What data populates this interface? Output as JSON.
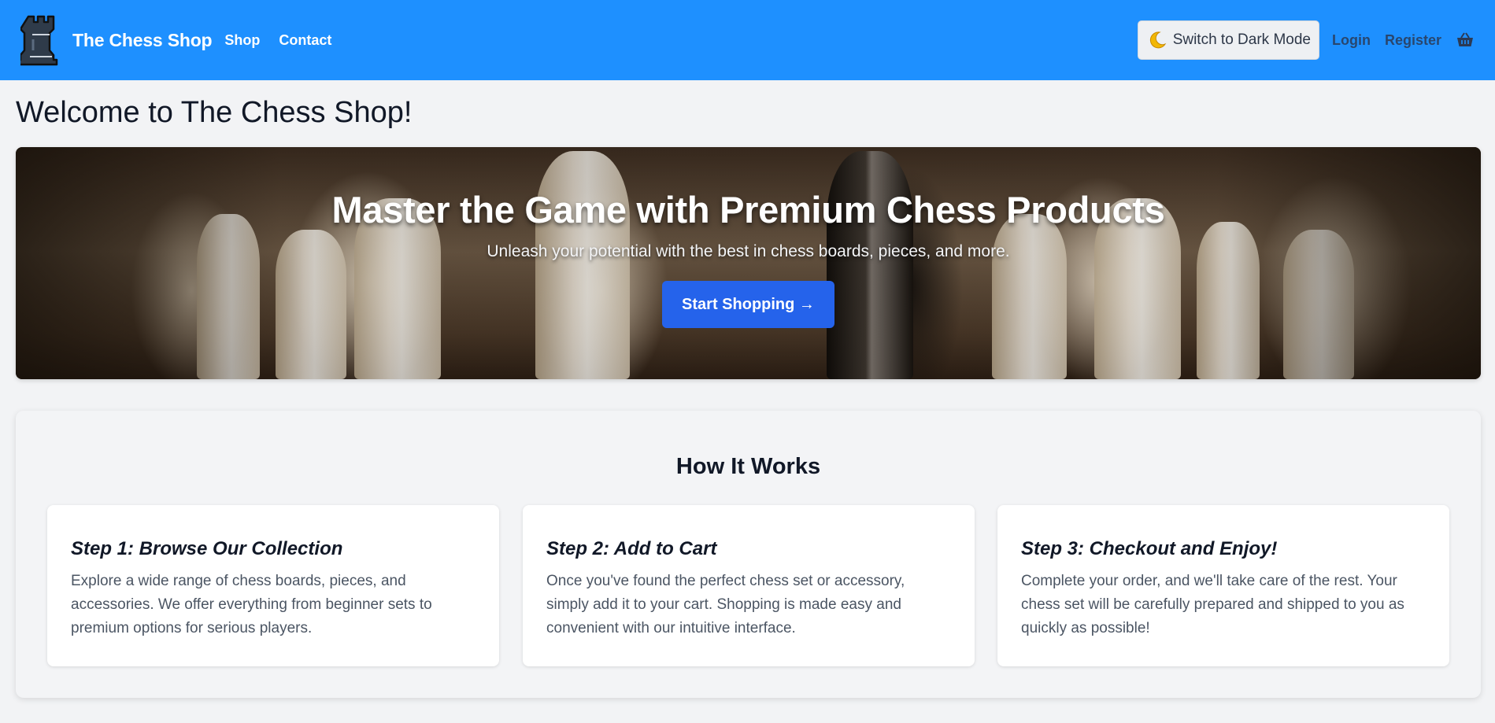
{
  "header": {
    "brand": "The Chess Shop",
    "nav": [
      "Shop",
      "Contact"
    ],
    "dark_mode_label": "Switch to Dark Mode",
    "login": "Login",
    "register": "Register",
    "icons": {
      "logo": "rook-logo-icon",
      "moon": "moon-icon",
      "cart": "cart-icon"
    }
  },
  "page": {
    "title": "Welcome to The Chess Shop!"
  },
  "hero": {
    "title": "Master the Game with Premium Chess Products",
    "subtitle": "Unleash your potential with the best in chess boards, pieces, and more.",
    "cta": "Start Shopping →"
  },
  "how": {
    "title": "How It Works",
    "steps": [
      {
        "title": "Step 1: Browse Our Collection",
        "text": "Explore a wide range of chess boards, pieces, and accessories. We offer everything from beginner sets to premium options for serious players."
      },
      {
        "title": "Step 2: Add to Cart",
        "text": "Once you've found the perfect chess set or accessory, simply add it to your cart. Shopping is made easy and convenient with our intuitive interface."
      },
      {
        "title": "Step 3: Checkout and Enjoy!",
        "text": "Complete your order, and we'll take care of the rest. Your chess set will be carefully prepared and shipped to you as quickly as possible!"
      }
    ]
  },
  "colors": {
    "navbar": "#1e90ff",
    "cta": "#2563eb",
    "background": "#f2f3f5"
  }
}
